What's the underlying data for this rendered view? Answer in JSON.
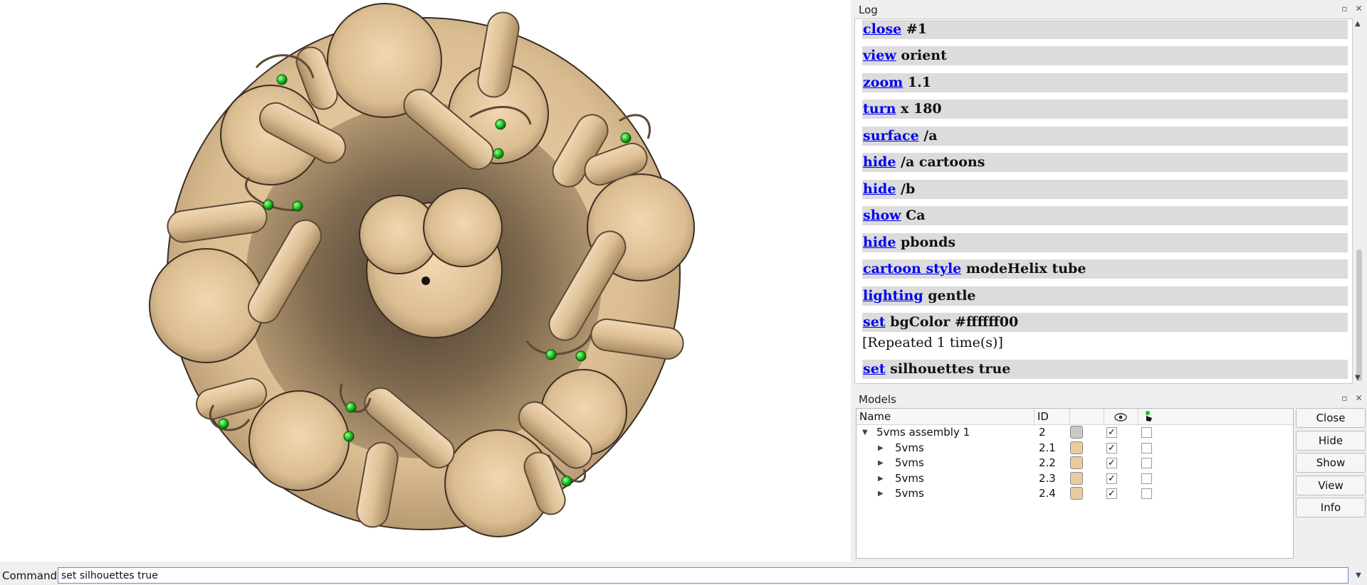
{
  "log": {
    "title": "Log",
    "entries": [
      {
        "cmd": "close",
        "args": " #1"
      },
      {
        "cmd": "view",
        "args": " orient"
      },
      {
        "cmd": "zoom",
        "args": " 1.1"
      },
      {
        "cmd": "turn",
        "args": " x 180"
      },
      {
        "cmd": "surface",
        "args": " /a"
      },
      {
        "cmd": "hide",
        "args": " /a cartoons"
      },
      {
        "cmd": "hide",
        "args": " /b"
      },
      {
        "cmd": "show",
        "args": " Ca"
      },
      {
        "cmd": "hide",
        "args": " pbonds"
      },
      {
        "cmd": "cartoon style",
        "args": " modeHelix tube"
      },
      {
        "cmd": "lighting",
        "args": " gentle"
      },
      {
        "cmd": "set",
        "args": " bgColor #ffffff00",
        "note": "[Repeated 1 time(s)]"
      },
      {
        "cmd": "set",
        "args": " silhouettes true"
      }
    ]
  },
  "models": {
    "title": "Models",
    "columns": {
      "name": "Name",
      "id": "ID"
    },
    "rows": [
      {
        "name": "5vms assembly 1",
        "id": "2",
        "color": "#c8c8c8",
        "shown": "✓",
        "selected": ""
      },
      {
        "name": "5vms",
        "id": "2.1",
        "color": "#e9cba0",
        "shown": "✓",
        "selected": ""
      },
      {
        "name": "5vms",
        "id": "2.2",
        "color": "#e9cba0",
        "shown": "✓",
        "selected": ""
      },
      {
        "name": "5vms",
        "id": "2.3",
        "color": "#e9cba0",
        "shown": "✓",
        "selected": ""
      },
      {
        "name": "5vms",
        "id": "2.4",
        "color": "#e9cba0",
        "shown": "✓",
        "selected": ""
      }
    ],
    "buttons": [
      "Close",
      "Hide",
      "Show",
      "View",
      "Info"
    ]
  },
  "command": {
    "label": "Command:",
    "value": "set silhouettes true"
  },
  "colors": {
    "protein": "#ddc094",
    "calcium": "#22c222",
    "link": "#0000ee",
    "log_row": "#dcdcdc"
  }
}
